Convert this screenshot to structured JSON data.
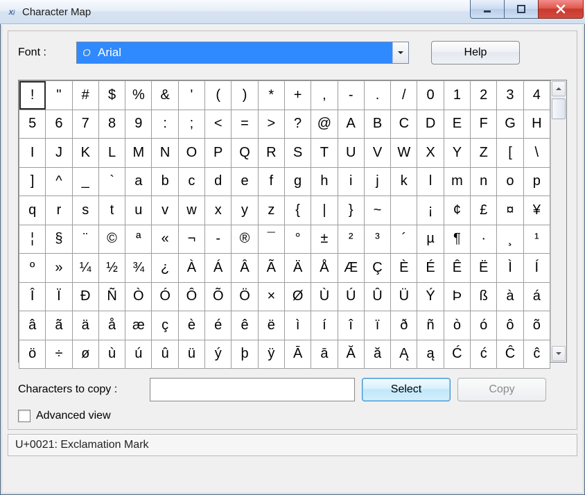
{
  "title": "Character Map",
  "font_label": "Font :",
  "font_value": "Arial",
  "help_label": "Help",
  "copy_label": "Characters to copy :",
  "copy_value": "",
  "select_label": "Select",
  "copy_btn_label": "Copy",
  "advanced_label": "Advanced view",
  "advanced_checked": false,
  "status_text": "U+0021: Exclamation Mark",
  "selected_char": "!",
  "grid": [
    [
      "!",
      "\"",
      "#",
      "$",
      "%",
      "&",
      "'",
      "(",
      ")",
      "*",
      "+",
      ",",
      "-",
      ".",
      "/",
      "0",
      "1",
      "2",
      "3",
      "4"
    ],
    [
      "5",
      "6",
      "7",
      "8",
      "9",
      ":",
      ";",
      "<",
      "=",
      ">",
      "?",
      "@",
      "A",
      "B",
      "C",
      "D",
      "E",
      "F",
      "G",
      "H"
    ],
    [
      "I",
      "J",
      "K",
      "L",
      "M",
      "N",
      "O",
      "P",
      "Q",
      "R",
      "S",
      "T",
      "U",
      "V",
      "W",
      "X",
      "Y",
      "Z",
      "[",
      "\\"
    ],
    [
      "]",
      "^",
      "_",
      "`",
      "a",
      "b",
      "c",
      "d",
      "e",
      "f",
      "g",
      "h",
      "i",
      "j",
      "k",
      "l",
      "m",
      "n",
      "o",
      "p"
    ],
    [
      "q",
      "r",
      "s",
      "t",
      "u",
      "v",
      "w",
      "x",
      "y",
      "z",
      "{",
      "|",
      "}",
      "~",
      " ",
      "¡",
      "¢",
      "£",
      "¤",
      "¥"
    ],
    [
      "¦",
      "§",
      "¨",
      "©",
      "ª",
      "«",
      "¬",
      "-",
      "®",
      "¯",
      "°",
      "±",
      "²",
      "³",
      "´",
      "µ",
      "¶",
      "·",
      "¸",
      "¹"
    ],
    [
      "º",
      "»",
      "¼",
      "½",
      "¾",
      "¿",
      "À",
      "Á",
      "Â",
      "Ã",
      "Ä",
      "Å",
      "Æ",
      "Ç",
      "È",
      "É",
      "Ê",
      "Ë",
      "Ì",
      "Í"
    ],
    [
      "Î",
      "Ï",
      "Đ",
      "Ñ",
      "Ò",
      "Ó",
      "Ô",
      "Õ",
      "Ö",
      "×",
      "Ø",
      "Ù",
      "Ú",
      "Û",
      "Ü",
      "Ý",
      "Þ",
      "ß",
      "à",
      "á"
    ],
    [
      "â",
      "ã",
      "ä",
      "å",
      "æ",
      "ç",
      "è",
      "é",
      "ê",
      "ë",
      "ì",
      "í",
      "î",
      "ï",
      "ð",
      "ñ",
      "ò",
      "ó",
      "ô",
      "õ"
    ],
    [
      "ö",
      "÷",
      "ø",
      "ù",
      "ú",
      "û",
      "ü",
      "ý",
      "þ",
      "ÿ",
      "Ā",
      "ā",
      "Ă",
      "ă",
      "Ą",
      "ą",
      "Ć",
      "ć",
      "Ĉ",
      "ĉ"
    ]
  ]
}
